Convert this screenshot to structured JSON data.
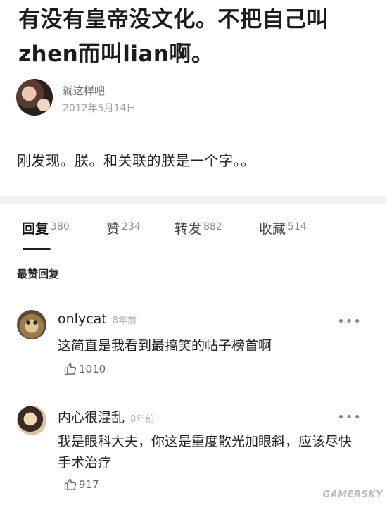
{
  "post": {
    "title": "有没有皇帝没文化。不把自己叫zhen而叫lian啊。",
    "author": "就这样吧",
    "date": "2012年5月14日",
    "body": "刚发现。朕。和关联的朕是一个字。。"
  },
  "tabs": [
    {
      "label": "回复",
      "count": "380",
      "active": true
    },
    {
      "label": "赞",
      "count": "234"
    },
    {
      "label": "转发",
      "count": "882"
    },
    {
      "label": "收藏",
      "count": "514"
    }
  ],
  "section_title": "最赞回复",
  "comments": [
    {
      "name": "onlycat",
      "time": "8年前",
      "text": "这简直是我看到最搞笑的帖子榜首啊",
      "likes": "1010",
      "more": "•••"
    },
    {
      "name": "内心很混乱",
      "time": "8年前",
      "text": "我是眼科大夫，你这是重度散光加眼斜，应该尽快手术治疗",
      "likes": "917",
      "more": "•••"
    }
  ],
  "icons": [
    "thumbs-up-icon",
    "more-icon"
  ],
  "watermark": "GAMERSKY"
}
